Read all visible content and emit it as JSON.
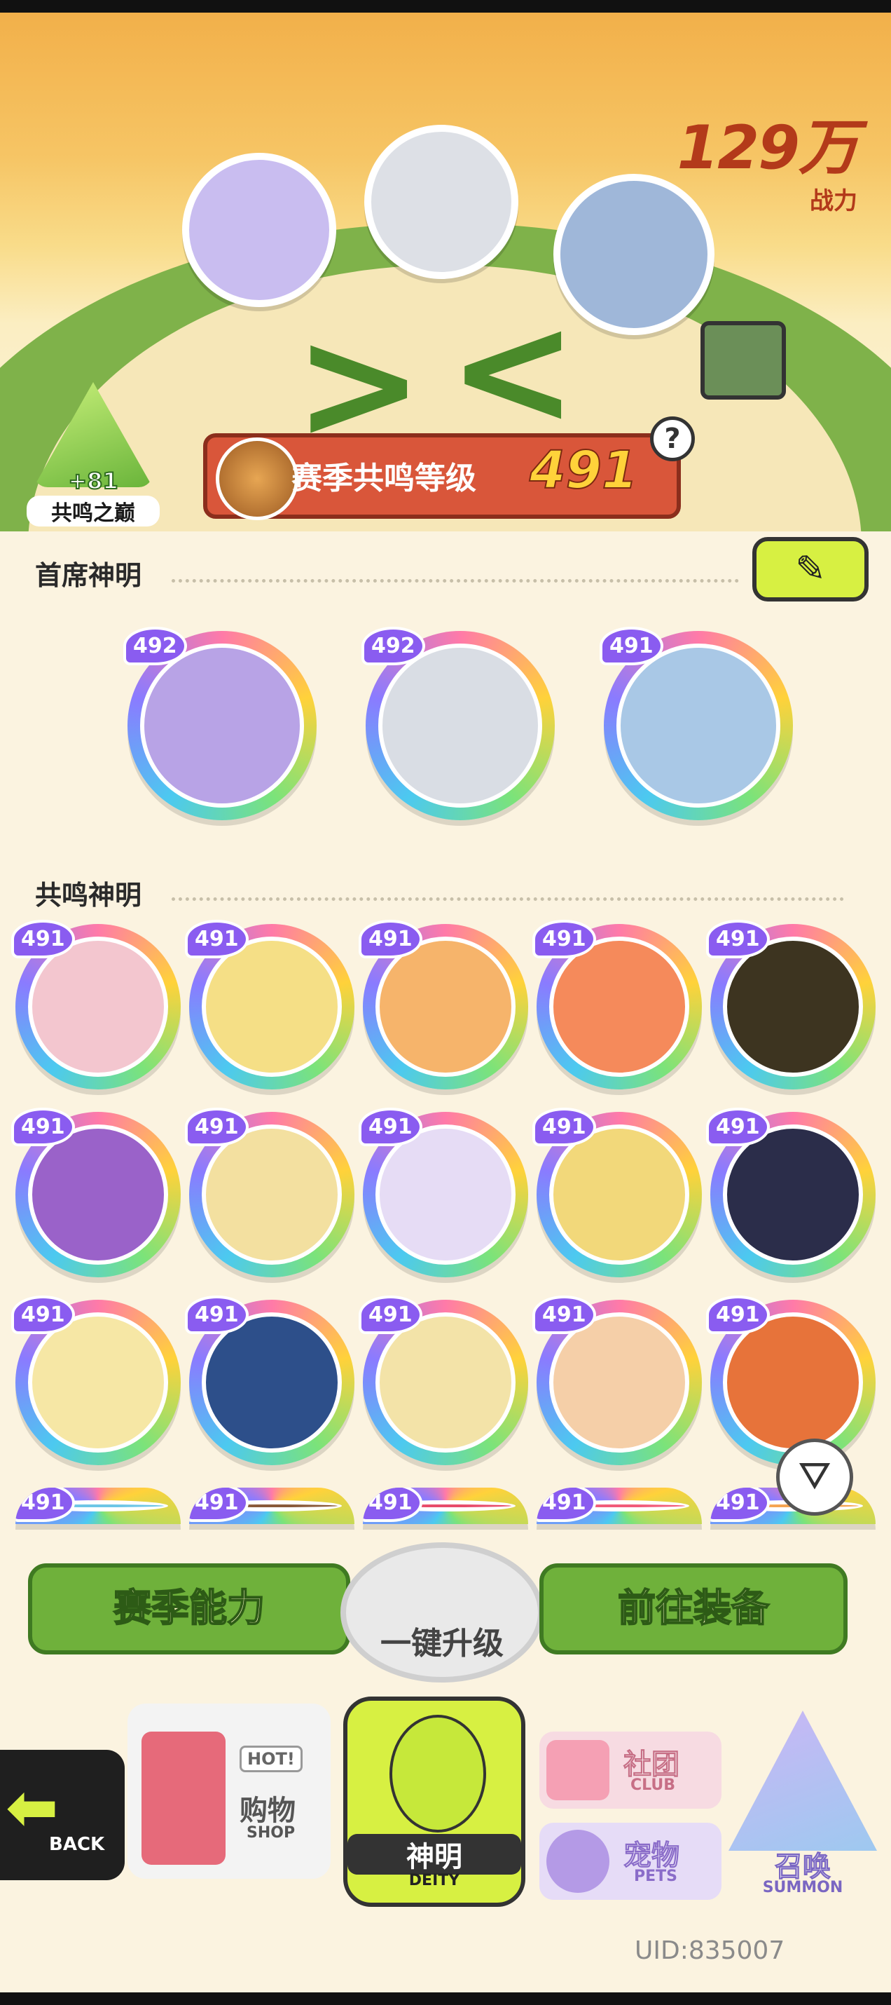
{
  "hero": {
    "power_value": "129万",
    "power_label": "战力"
  },
  "resonance_peak": {
    "level_bonus": "+81",
    "label": "共鸣之巅"
  },
  "season_resonance": {
    "label": "赛季共鸣等级",
    "level": "491"
  },
  "sections": {
    "chief_deities": "首席神明",
    "resonance_deities": "共鸣神明"
  },
  "chief_cards": [
    {
      "level": "492",
      "color": "#b8a3e6"
    },
    {
      "level": "492",
      "color": "#d9dde4"
    },
    {
      "level": "491",
      "color": "#a9c8e6"
    }
  ],
  "resonance_cards": [
    {
      "level": "491",
      "color": "#f3c6cf"
    },
    {
      "level": "491",
      "color": "#f5df86"
    },
    {
      "level": "491",
      "color": "#f6b46b"
    },
    {
      "level": "491",
      "color": "#f58a5b"
    },
    {
      "level": "491",
      "color": "#3d3420"
    },
    {
      "level": "491",
      "color": "#9a62c9"
    },
    {
      "level": "491",
      "color": "#f3e0a0"
    },
    {
      "level": "491",
      "color": "#e6dcf5"
    },
    {
      "level": "491",
      "color": "#f2d87a"
    },
    {
      "level": "491",
      "color": "#2b2d4a"
    },
    {
      "level": "491",
      "color": "#f6e7a5"
    },
    {
      "level": "491",
      "color": "#2d4f8a"
    },
    {
      "level": "491",
      "color": "#f3e3a8"
    },
    {
      "level": "491",
      "color": "#f5cfa8"
    },
    {
      "level": "491",
      "color": "#e7733a"
    },
    {
      "level": "491",
      "color": "#6ec6e6"
    },
    {
      "level": "491",
      "color": "#8a5a3a"
    },
    {
      "level": "491",
      "color": "#e84c6b"
    },
    {
      "level": "491",
      "color": "#f25b7a"
    },
    {
      "level": "491",
      "color": "#f5a552"
    }
  ],
  "actions": {
    "season_ability": "赛季能力",
    "one_click_upgrade": "一键升级",
    "go_equipment": "前往装备"
  },
  "nav": {
    "back": "BACK",
    "shop_cn": "购物",
    "shop_en": "SHOP",
    "shop_badge": "HOT!",
    "deity_cn": "神明",
    "deity_en": "DEITY",
    "club_cn": "社团",
    "club_en": "CLUB",
    "pets_cn": "宠物",
    "pets_en": "PETS",
    "summon_cn": "召唤",
    "summon_en": "SUMMON"
  },
  "uid": "UID:835007"
}
